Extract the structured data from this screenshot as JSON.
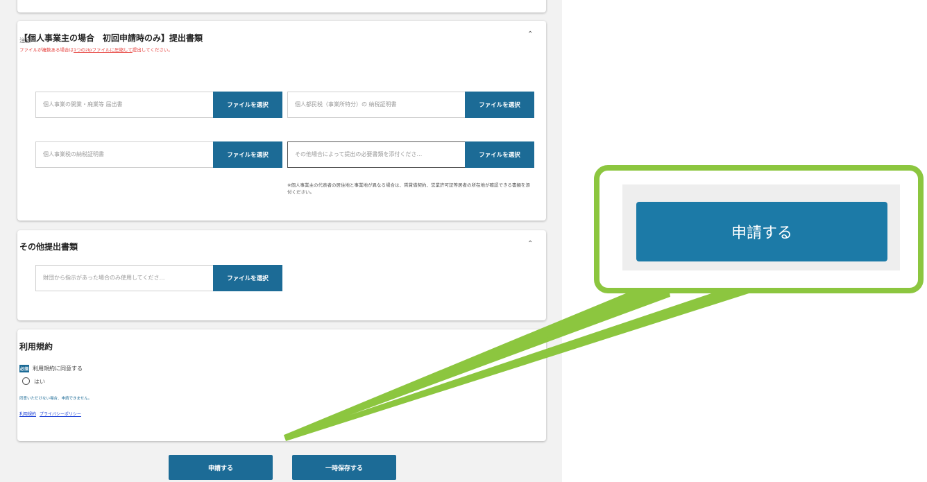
{
  "sections": {
    "individual": {
      "title": "【個人事業主の場合　初回申請時のみ】提出書類",
      "collapse_icon": "chevron-up-icon",
      "note_label": "注意",
      "note_pre": "ファイルが複数ある場合は",
      "note_underlined": "1つのzipファイルに圧縮して",
      "note_post": "提出してください。",
      "fields": [
        {
          "placeholder": "個人事業の開業・廃業等 届出書",
          "button": "ファイルを選択"
        },
        {
          "placeholder": "個人都民税（事業所特分）の 納税証明書",
          "button": "ファイルを選択"
        },
        {
          "placeholder": "個人事業税の納税証明書",
          "button": "ファイルを選択"
        },
        {
          "placeholder": "その他場合によって提出の必要書類を添付くださ…",
          "button": "ファイルを選択"
        }
      ],
      "footnote": "※個人事業主の代表者の居住地と事業地が異なる場合は、賃貸借契約、営業許可証等居者の所在地が確認できる書類を添付ください。"
    },
    "other": {
      "title": "その他提出書類",
      "collapse_icon": "chevron-up-icon",
      "field": {
        "placeholder": "財団から指示があった場合のみ使用してくださ…",
        "button": "ファイルを選択"
      }
    },
    "terms": {
      "title": "利用規約",
      "required_badge": "必須",
      "agree_label": "利用規約に同意する",
      "option_yes": "はい",
      "warning": "同意いただけない場合、申請できません。",
      "link_terms": "利用規約",
      "link_privacy": "プライバシーポリシー"
    }
  },
  "actions": {
    "submit": "申請する",
    "save_draft": "一時保存する"
  },
  "callout": {
    "button_label": "申請する",
    "highlight_color": "#8cc63f"
  },
  "colors": {
    "primary": "#1c6b96",
    "warning": "#e53935"
  }
}
